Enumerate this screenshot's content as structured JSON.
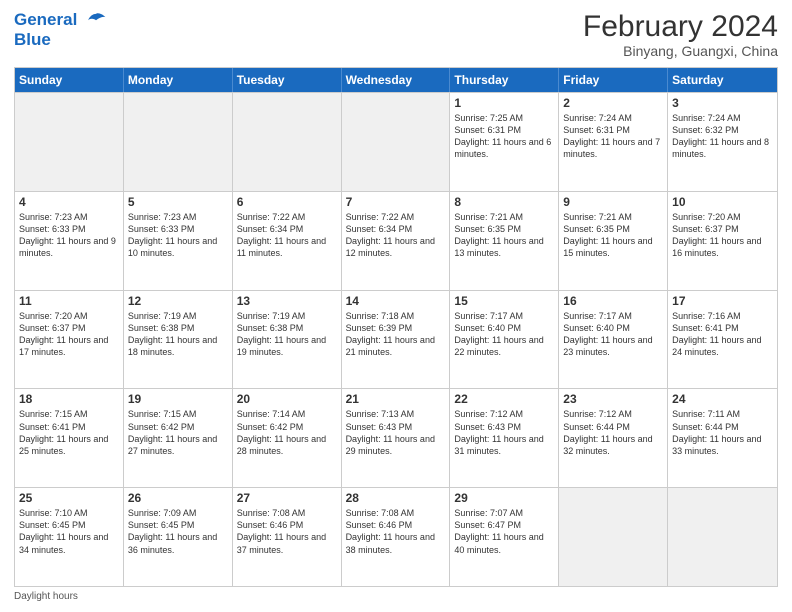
{
  "header": {
    "logo_line1": "General",
    "logo_line2": "Blue",
    "month": "February 2024",
    "location": "Binyang, Guangxi, China"
  },
  "days_of_week": [
    "Sunday",
    "Monday",
    "Tuesday",
    "Wednesday",
    "Thursday",
    "Friday",
    "Saturday"
  ],
  "weeks": [
    [
      {
        "day": "",
        "info": "",
        "shaded": true
      },
      {
        "day": "",
        "info": "",
        "shaded": true
      },
      {
        "day": "",
        "info": "",
        "shaded": true
      },
      {
        "day": "",
        "info": "",
        "shaded": true
      },
      {
        "day": "1",
        "info": "Sunrise: 7:25 AM\nSunset: 6:31 PM\nDaylight: 11 hours and 6 minutes."
      },
      {
        "day": "2",
        "info": "Sunrise: 7:24 AM\nSunset: 6:31 PM\nDaylight: 11 hours and 7 minutes."
      },
      {
        "day": "3",
        "info": "Sunrise: 7:24 AM\nSunset: 6:32 PM\nDaylight: 11 hours and 8 minutes."
      }
    ],
    [
      {
        "day": "4",
        "info": "Sunrise: 7:23 AM\nSunset: 6:33 PM\nDaylight: 11 hours and 9 minutes."
      },
      {
        "day": "5",
        "info": "Sunrise: 7:23 AM\nSunset: 6:33 PM\nDaylight: 11 hours and 10 minutes."
      },
      {
        "day": "6",
        "info": "Sunrise: 7:22 AM\nSunset: 6:34 PM\nDaylight: 11 hours and 11 minutes."
      },
      {
        "day": "7",
        "info": "Sunrise: 7:22 AM\nSunset: 6:34 PM\nDaylight: 11 hours and 12 minutes."
      },
      {
        "day": "8",
        "info": "Sunrise: 7:21 AM\nSunset: 6:35 PM\nDaylight: 11 hours and 13 minutes."
      },
      {
        "day": "9",
        "info": "Sunrise: 7:21 AM\nSunset: 6:35 PM\nDaylight: 11 hours and 15 minutes."
      },
      {
        "day": "10",
        "info": "Sunrise: 7:20 AM\nSunset: 6:37 PM\nDaylight: 11 hours and 16 minutes."
      }
    ],
    [
      {
        "day": "11",
        "info": "Sunrise: 7:20 AM\nSunset: 6:37 PM\nDaylight: 11 hours and 17 minutes."
      },
      {
        "day": "12",
        "info": "Sunrise: 7:19 AM\nSunset: 6:38 PM\nDaylight: 11 hours and 18 minutes."
      },
      {
        "day": "13",
        "info": "Sunrise: 7:19 AM\nSunset: 6:38 PM\nDaylight: 11 hours and 19 minutes."
      },
      {
        "day": "14",
        "info": "Sunrise: 7:18 AM\nSunset: 6:39 PM\nDaylight: 11 hours and 21 minutes."
      },
      {
        "day": "15",
        "info": "Sunrise: 7:17 AM\nSunset: 6:40 PM\nDaylight: 11 hours and 22 minutes."
      },
      {
        "day": "16",
        "info": "Sunrise: 7:17 AM\nSunset: 6:40 PM\nDaylight: 11 hours and 23 minutes."
      },
      {
        "day": "17",
        "info": "Sunrise: 7:16 AM\nSunset: 6:41 PM\nDaylight: 11 hours and 24 minutes."
      }
    ],
    [
      {
        "day": "18",
        "info": "Sunrise: 7:15 AM\nSunset: 6:41 PM\nDaylight: 11 hours and 25 minutes."
      },
      {
        "day": "19",
        "info": "Sunrise: 7:15 AM\nSunset: 6:42 PM\nDaylight: 11 hours and 27 minutes."
      },
      {
        "day": "20",
        "info": "Sunrise: 7:14 AM\nSunset: 6:42 PM\nDaylight: 11 hours and 28 minutes."
      },
      {
        "day": "21",
        "info": "Sunrise: 7:13 AM\nSunset: 6:43 PM\nDaylight: 11 hours and 29 minutes."
      },
      {
        "day": "22",
        "info": "Sunrise: 7:12 AM\nSunset: 6:43 PM\nDaylight: 11 hours and 31 minutes."
      },
      {
        "day": "23",
        "info": "Sunrise: 7:12 AM\nSunset: 6:44 PM\nDaylight: 11 hours and 32 minutes."
      },
      {
        "day": "24",
        "info": "Sunrise: 7:11 AM\nSunset: 6:44 PM\nDaylight: 11 hours and 33 minutes."
      }
    ],
    [
      {
        "day": "25",
        "info": "Sunrise: 7:10 AM\nSunset: 6:45 PM\nDaylight: 11 hours and 34 minutes."
      },
      {
        "day": "26",
        "info": "Sunrise: 7:09 AM\nSunset: 6:45 PM\nDaylight: 11 hours and 36 minutes."
      },
      {
        "day": "27",
        "info": "Sunrise: 7:08 AM\nSunset: 6:46 PM\nDaylight: 11 hours and 37 minutes."
      },
      {
        "day": "28",
        "info": "Sunrise: 7:08 AM\nSunset: 6:46 PM\nDaylight: 11 hours and 38 minutes."
      },
      {
        "day": "29",
        "info": "Sunrise: 7:07 AM\nSunset: 6:47 PM\nDaylight: 11 hours and 40 minutes."
      },
      {
        "day": "",
        "info": "",
        "shaded": true
      },
      {
        "day": "",
        "info": "",
        "shaded": true
      }
    ]
  ],
  "footer": "Daylight hours"
}
